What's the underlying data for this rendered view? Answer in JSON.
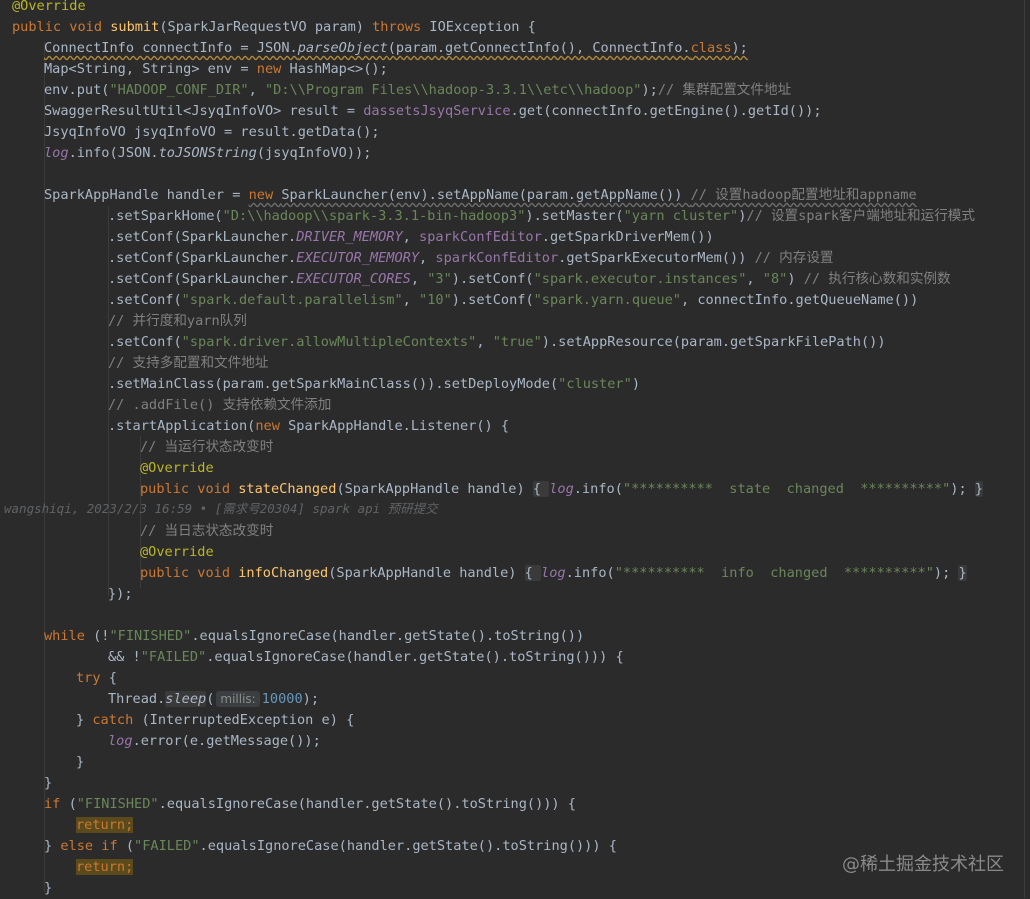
{
  "code": {
    "l1": "@Override",
    "l2a": "public void ",
    "l2b": "submit",
    "l2c": "(SparkJarRequestVO param) ",
    "l2d": "throws ",
    "l2e": "IOException {",
    "l3a": "ConnectInfo connectInfo = JSON.",
    "l3b": "parseObject",
    "l3c": "(param.getConnectInfo(), ConnectInfo.",
    "l3d": "class",
    "l3e": ");",
    "l4a": "Map<String, String> env = ",
    "l4b": "new ",
    "l4c": "HashMap<>();",
    "l5a": "env.put(",
    "l5b": "\"HADOOP_CONF_DIR\"",
    "l5c": ", ",
    "l5d": "\"D:\\\\Program Files\\\\hadoop-3.3.1\\\\etc\\\\hadoop\"",
    "l5e": ");",
    "l5f": "// 集群配置文件地址",
    "l6a": "SwaggerResultUtil<JsyqInfoVO> result = ",
    "l6b": "dassetsJsyqService",
    "l6c": ".get(connectInfo.getEngine().getId());",
    "l7": "JsyqInfoVO jsyqInfoVO = result.getData();",
    "l8a": "log",
    "l8b": ".info(JSON.",
    "l8c": "toJSONString",
    "l8d": "(jsyqInfoVO));",
    "l10a": "SparkAppHandle handler = ",
    "l10b": "new ",
    "l10c": "SparkLauncher(env).setAppName(param.getAppName()) ",
    "l10d": "// 设置hadoop配置地址和appname",
    "l11a": ".setSparkHome(",
    "l11b": "\"D:\\\\hadoop\\\\spark-3.3.1-bin-hadoop3\"",
    "l11c": ").setMaster(",
    "l11d": "\"yarn cluster\"",
    "l11e": ")",
    "l11f": "// 设置spark客户端地址和运行模式",
    "l12a": ".setConf(SparkLauncher.",
    "l12b": "DRIVER_MEMORY",
    "l12c": ", ",
    "l12d": "sparkConfEditor",
    "l12e": ".getSparkDriverMem())",
    "l13a": ".setConf(SparkLauncher.",
    "l13b": "EXECUTOR_MEMORY",
    "l13c": ", ",
    "l13d": "sparkConfEditor",
    "l13e": ".getSparkExecutorMem()) ",
    "l13f": "// 内存设置",
    "l14a": ".setConf(SparkLauncher.",
    "l14b": "EXECUTOR_CORES",
    "l14c": ", ",
    "l14d": "\"3\"",
    "l14e": ").setConf(",
    "l14f": "\"spark.executor.instances\"",
    "l14g": ", ",
    "l14h": "\"8\"",
    "l14i": ") ",
    "l14j": "// 执行核心数和实例数",
    "l15a": ".setConf(",
    "l15b": "\"spark.default.parallelism\"",
    "l15c": ", ",
    "l15d": "\"10\"",
    "l15e": ").setConf(",
    "l15f": "\"spark.yarn.queue\"",
    "l15g": ", connectInfo.getQueueName())",
    "l16": "// 并行度和yarn队列",
    "l17a": ".setConf(",
    "l17b": "\"spark.driver.allowMultipleContexts\"",
    "l17c": ", ",
    "l17d": "\"true\"",
    "l17e": ").setAppResource(param.getSparkFilePath())",
    "l18": "// 支持多配置和文件地址",
    "l19a": ".setMainClass(param.getSparkMainClass()).setDeployMode(",
    "l19b": "\"cluster\"",
    "l19c": ")",
    "l20": "// .addFile() 支持依赖文件添加",
    "l21a": ".startApplication(",
    "l21b": "new ",
    "l21c": "SparkAppHandle.Listener() {",
    "l22": "// 当运行状态改变时",
    "l23": "@Override",
    "l24a": "public void ",
    "l24b": "stateChanged",
    "l24c": "(SparkAppHandle handle) ",
    "l24d": "{ ",
    "l24e": "log",
    "l24f": ".info(",
    "l24g": "\"**********  state  changed  **********\"",
    "l24h": "); ",
    "l24i": "}",
    "blame": "wangshiqi, 2023/2/3 16:59 • [需求号20304] spark api 预研提交",
    "l26": "// 当日志状态改变时",
    "l27": "@Override",
    "l28a": "public void ",
    "l28b": "infoChanged",
    "l28c": "(SparkAppHandle handle) ",
    "l28d": "{ ",
    "l28e": "log",
    "l28f": ".info(",
    "l28g": "\"**********  info  changed  **********\"",
    "l28h": "); ",
    "l28i": "}",
    "l29": "});",
    "l31a": "while ",
    "l31b": "(!",
    "l31c": "\"FINISHED\"",
    "l31d": ".equalsIgnoreCase(handler.getState().toString())",
    "l32a": "&& !",
    "l32b": "\"FAILED\"",
    "l32c": ".equalsIgnoreCase(handler.getState().toString())) {",
    "l33a": "try ",
    "l33b": "{",
    "l34a": "Thread.",
    "l34b": "sleep",
    "l34c": "(",
    "l34hint": "millis:",
    "l34d": "10000",
    "l34e": ");",
    "l35a": "} ",
    "l35b": "catch ",
    "l35c": "(InterruptedException e) {",
    "l36a": "log",
    "l36b": ".error(e.getMessage());",
    "l37": "}",
    "l38": "}",
    "l39a": "if ",
    "l39b": "(",
    "l39c": "\"FINISHED\"",
    "l39d": ".equalsIgnoreCase(handler.getState().toString())) {",
    "l40a": "return",
    "l40b": ";",
    "l41a": "} ",
    "l41b": "else if ",
    "l41c": "(",
    "l41d": "\"FAILED\"",
    "l41e": ".equalsIgnoreCase(handler.getState().toString())) {",
    "l42a": "return",
    "l42b": ";",
    "l43": "}"
  },
  "watermark": "@稀土掘金技术社区"
}
